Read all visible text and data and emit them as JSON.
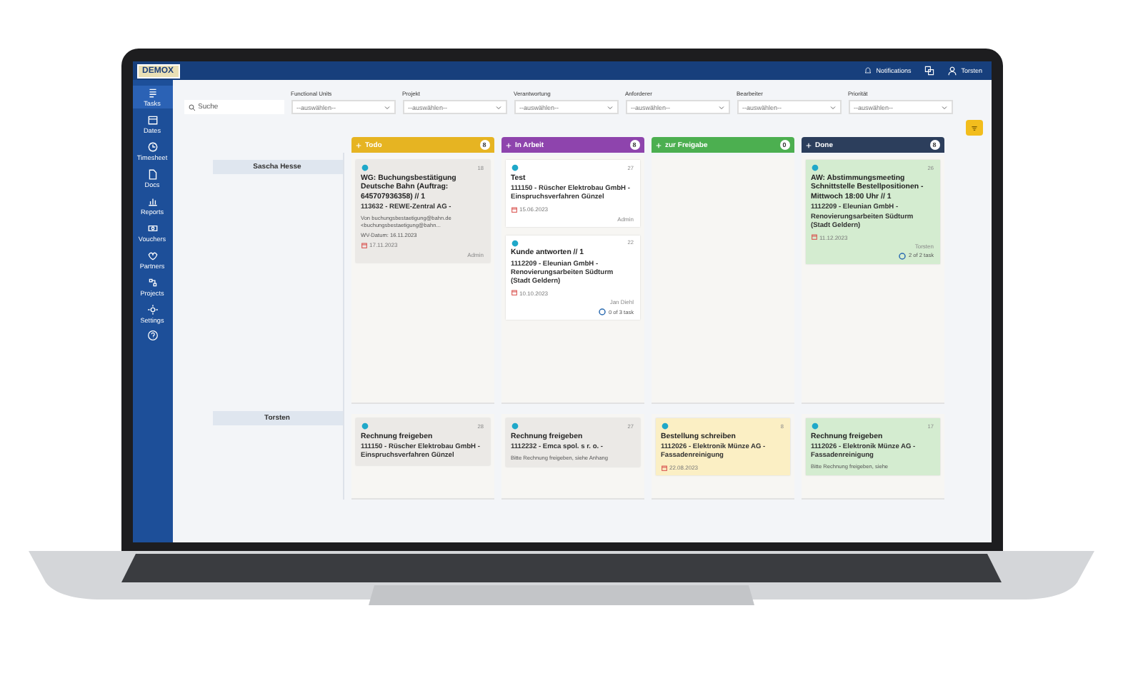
{
  "topbar": {
    "logo": "DEMOX",
    "notifications": "Notifications",
    "user": "Torsten"
  },
  "sidebar": {
    "items": [
      {
        "label": "Tasks",
        "selected": true
      },
      {
        "label": "Dates",
        "selected": false
      },
      {
        "label": "Timesheet",
        "selected": false
      },
      {
        "label": "Docs",
        "selected": false
      },
      {
        "label": "Reports",
        "selected": false
      },
      {
        "label": "Vouchers",
        "selected": false
      },
      {
        "label": "Partners",
        "selected": false
      },
      {
        "label": "Projects",
        "selected": false
      },
      {
        "label": "Settings",
        "selected": false
      }
    ]
  },
  "search": {
    "placeholder": "Suche"
  },
  "filters": [
    {
      "label": "Functional Units",
      "value": "--auswählen--"
    },
    {
      "label": "Projekt",
      "value": "--auswählen--"
    },
    {
      "label": "Verantwortung",
      "value": "--auswählen--"
    },
    {
      "label": "Anforderer",
      "value": "--auswählen--"
    },
    {
      "label": "Bearbeiter",
      "value": "--auswählen--"
    },
    {
      "label": "Priorität",
      "value": "--auswählen--"
    }
  ],
  "columns": [
    {
      "name": "Todo",
      "count": "8",
      "color": "#e6b422"
    },
    {
      "name": "In Arbeit",
      "count": "8",
      "color": "#8e44ad"
    },
    {
      "name": "zur Freigabe",
      "count": "0",
      "color": "#4caf50"
    },
    {
      "name": "Done",
      "count": "8",
      "color": "#2c3e5c"
    }
  ],
  "lanes": [
    {
      "name": "Sascha Hesse",
      "cells": [
        [
          {
            "number": "18",
            "title": "WG: Buchungsbestätigung Deutsche Bahn (Auftrag: 645707936358) // 1",
            "project": "113632 - REWE-Zentral AG -",
            "description": "Von buchungsbestaetigung@bahn.de <buchungsbestaetigung@bahn...",
            "extra": "WV-Datum: 16.11.2023",
            "date": "17.11.2023",
            "assignee": "Admin",
            "color": "#ebe9e6"
          }
        ],
        [
          {
            "number": "27",
            "title": "Test",
            "project": "111150 - Rüscher Elektrobau GmbH - Einspruchsverfahren Günzel",
            "date": "15.06.2023",
            "assignee": "Admin",
            "color": "#ffffff"
          },
          {
            "number": "22",
            "title": "Kunde antworten // 1",
            "project": "1112209 - Eleunian GmbH - Renovierungsarbeiten Südturm (Stadt Geldern)",
            "date": "10.10.2023",
            "assignee": "Jan Diehl",
            "tasks": "0 of 3 task",
            "color": "#ffffff"
          }
        ],
        [],
        [
          {
            "number": "26",
            "title": "AW: Abstimmungsmeeting Schnittstelle Bestellpositionen - Mittwoch 18:00 Uhr // 1",
            "project": "1112209 - Eleunian GmbH - Renovierungsarbeiten Südturm (Stadt Geldern)",
            "date": "11.12.2023",
            "assignee": "Torsten",
            "tasks": "2 of 2 task",
            "color": "#d4ecd0"
          }
        ]
      ]
    },
    {
      "name": "Torsten",
      "cells": [
        [
          {
            "number": "28",
            "title": "Rechnung freigeben",
            "project": "111150 - Rüscher Elektrobau GmbH - Einspruchsverfahren Günzel",
            "color": "#ebe9e6"
          }
        ],
        [
          {
            "number": "27",
            "title": "Rechnung freigeben",
            "project": "1112232 - Emca spol. s r. o. -",
            "description": "Bitte Rechnung freigeben, siehe Anhang",
            "color": "#ebe9e6"
          }
        ],
        [
          {
            "number": "8",
            "title": "Bestellung schreiben",
            "project": "1112026 - Elektronik Münze AG - Fassadenreinigung",
            "date": "22.08.2023",
            "color": "#fbefc4"
          }
        ],
        [
          {
            "number": "17",
            "title": "Rechnung freigeben",
            "project": "1112026 - Elektronik Münze AG - Fassadenreinigung",
            "description": "Bitte Rechnung freigeben, siehe",
            "color": "#d4ecd0"
          }
        ]
      ]
    }
  ]
}
